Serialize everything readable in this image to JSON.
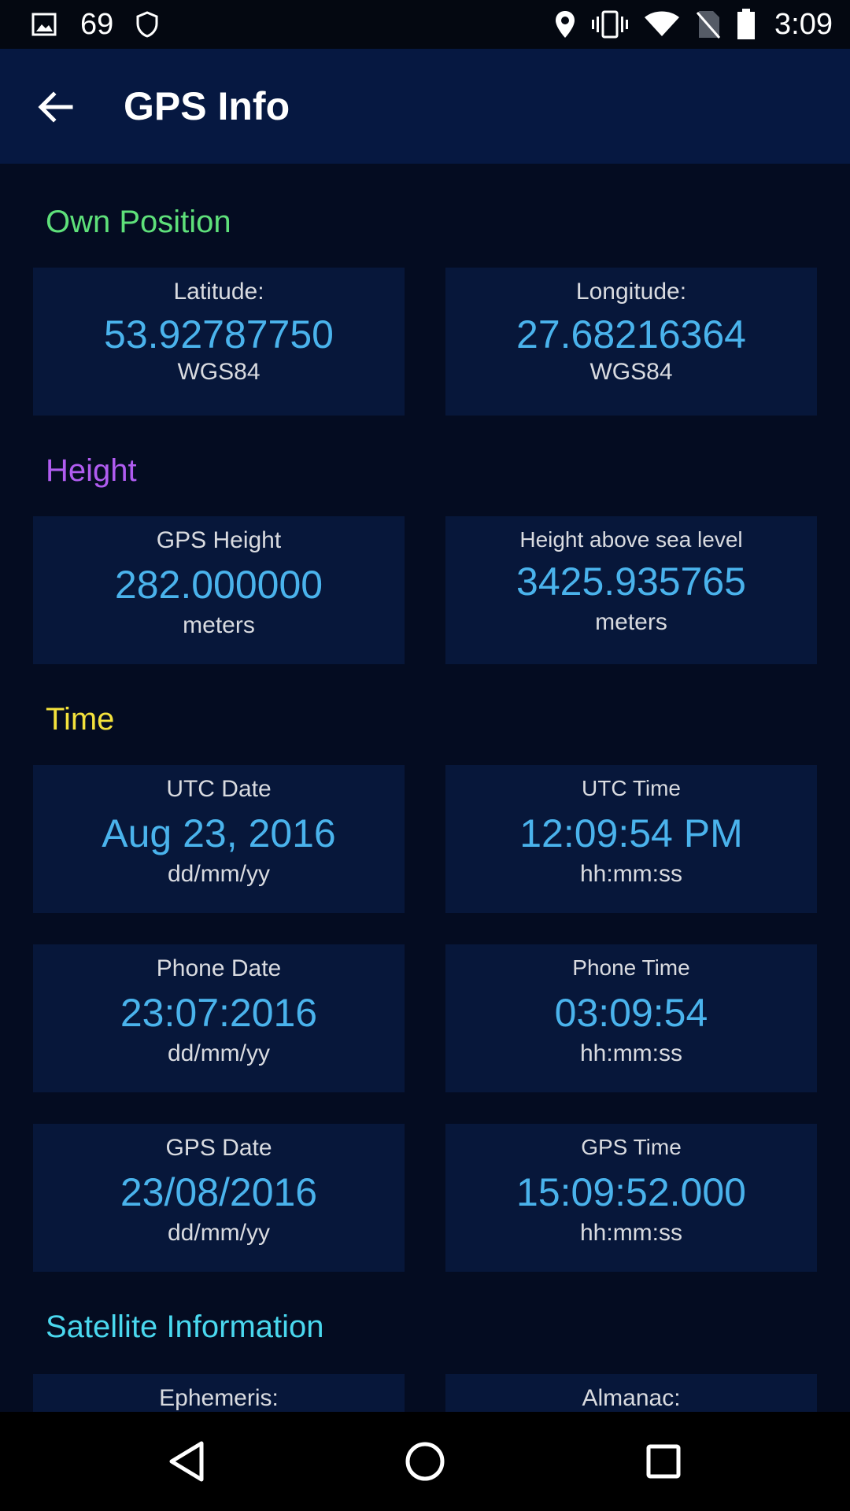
{
  "status_bar": {
    "notification_count": "69",
    "time": "3:09",
    "icons": [
      "image-icon",
      "shield-icon",
      "location-icon",
      "vibrate-icon",
      "wifi-icon",
      "no-sim-icon",
      "battery-icon"
    ]
  },
  "app_bar": {
    "title": "GPS Info",
    "back_icon": "arrow-back-icon"
  },
  "sections": {
    "own_position": {
      "title": "Own Position",
      "color": "#5ee07a",
      "cards": [
        {
          "label": "Latitude:",
          "value": "53.92787750",
          "unit": "WGS84"
        },
        {
          "label": "Longitude:",
          "value": "27.68216364",
          "unit": "WGS84"
        }
      ]
    },
    "height": {
      "title": "Height",
      "color": "#b05cf0",
      "cards": [
        {
          "label": "GPS Height",
          "value": "282.000000",
          "unit": "meters"
        },
        {
          "label": "Height above sea level",
          "value": "3425.935765",
          "unit": "meters"
        }
      ]
    },
    "time": {
      "title": "Time",
      "color": "#f4e23c",
      "cards": [
        {
          "label": "UTC Date",
          "value": "Aug 23, 2016",
          "unit": "dd/mm/yy"
        },
        {
          "label": "UTC Time",
          "value": "12:09:54 PM",
          "unit": "hh:mm:ss"
        },
        {
          "label": "Phone Date",
          "value": "23:07:2016",
          "unit": "dd/mm/yy"
        },
        {
          "label": "Phone Time",
          "value": "03:09:54",
          "unit": "hh:mm:ss"
        },
        {
          "label": "GPS Date",
          "value": "23/08/2016",
          "unit": "dd/mm/yy"
        },
        {
          "label": "GPS Time",
          "value": "15:09:52.000",
          "unit": "hh:mm:ss"
        }
      ]
    },
    "satellite": {
      "title": "Satellite Information",
      "color": "#4ad8ef",
      "cards": [
        {
          "label": "Ephemeris:"
        },
        {
          "label": "Almanac:"
        }
      ]
    }
  },
  "colors": {
    "background": "#040c21",
    "app_bar": "#061841",
    "card": "#07173a",
    "value": "#4ab3ec"
  },
  "nav_bar": {
    "icons": [
      "back-triangle-icon",
      "home-circle-icon",
      "recents-square-icon"
    ]
  }
}
